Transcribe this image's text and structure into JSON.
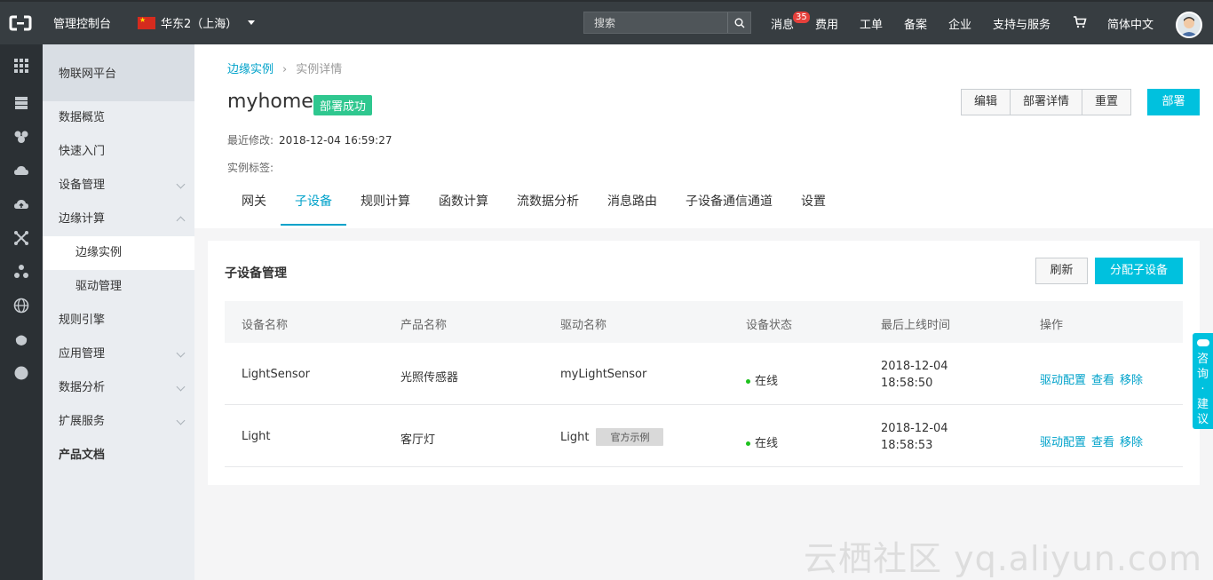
{
  "topbar": {
    "console": "管理控制台",
    "region": "华东2（上海）",
    "search_placeholder": "搜索",
    "nav": {
      "messages": "消息",
      "messages_count": "35",
      "billing": "费用",
      "tickets": "工单",
      "icp": "备案",
      "enterprise": "企业",
      "support": "支持与服务",
      "language": "简体中文"
    }
  },
  "sidebar": {
    "header": "物联网平台",
    "items": [
      {
        "label": "数据概览"
      },
      {
        "label": "快速入门"
      },
      {
        "label": "设备管理"
      },
      {
        "label": "边缘计算"
      },
      {
        "label": "边缘实例"
      },
      {
        "label": "驱动管理"
      },
      {
        "label": "规则引擎"
      },
      {
        "label": "应用管理"
      },
      {
        "label": "数据分析"
      },
      {
        "label": "扩展服务"
      },
      {
        "label": "产品文档"
      }
    ]
  },
  "breadcrumb": {
    "parent": "边缘实例",
    "current": "实例详情"
  },
  "instance": {
    "name": "myhome",
    "status": "部署成功",
    "modified_label": "最近修改:",
    "modified_value": "2018-12-04 16:59:27",
    "tags_label": "实例标签:"
  },
  "actions": {
    "edit": "编辑",
    "deploy_detail": "部署详情",
    "reset": "重置",
    "deploy": "部署"
  },
  "tabs": [
    "网关",
    "子设备",
    "规则计算",
    "函数计算",
    "流数据分析",
    "消息路由",
    "子设备通信通道",
    "设置"
  ],
  "card": {
    "title": "子设备管理",
    "refresh": "刷新",
    "assign": "分配子设备",
    "columns": [
      "设备名称",
      "产品名称",
      "驱动名称",
      "设备状态",
      "最后上线时间",
      "操作"
    ],
    "rows": [
      {
        "device": "LightSensor",
        "product": "光照传感器",
        "driver": "myLightSensor",
        "driver_tag": "",
        "status": "在线",
        "date": "2018-12-04",
        "time": "18:58:50",
        "ops": [
          "驱动配置",
          "查看",
          "移除"
        ]
      },
      {
        "device": "Light",
        "product": "客厅灯",
        "driver": "Light",
        "driver_tag": "官方示例",
        "status": "在线",
        "date": "2018-12-04",
        "time": "18:58:53",
        "ops": [
          "驱动配置",
          "查看",
          "移除"
        ]
      }
    ]
  },
  "feedback": {
    "c1": "咨",
    "c2": "询",
    "c3": "·",
    "c4": "建",
    "c5": "议"
  },
  "watermark": "云栖社区 yq.aliyun.com",
  "colors": {
    "accent": "#00c1de",
    "link": "#00a2ca",
    "topbar": "#373d41",
    "success": "#2fc78f"
  }
}
